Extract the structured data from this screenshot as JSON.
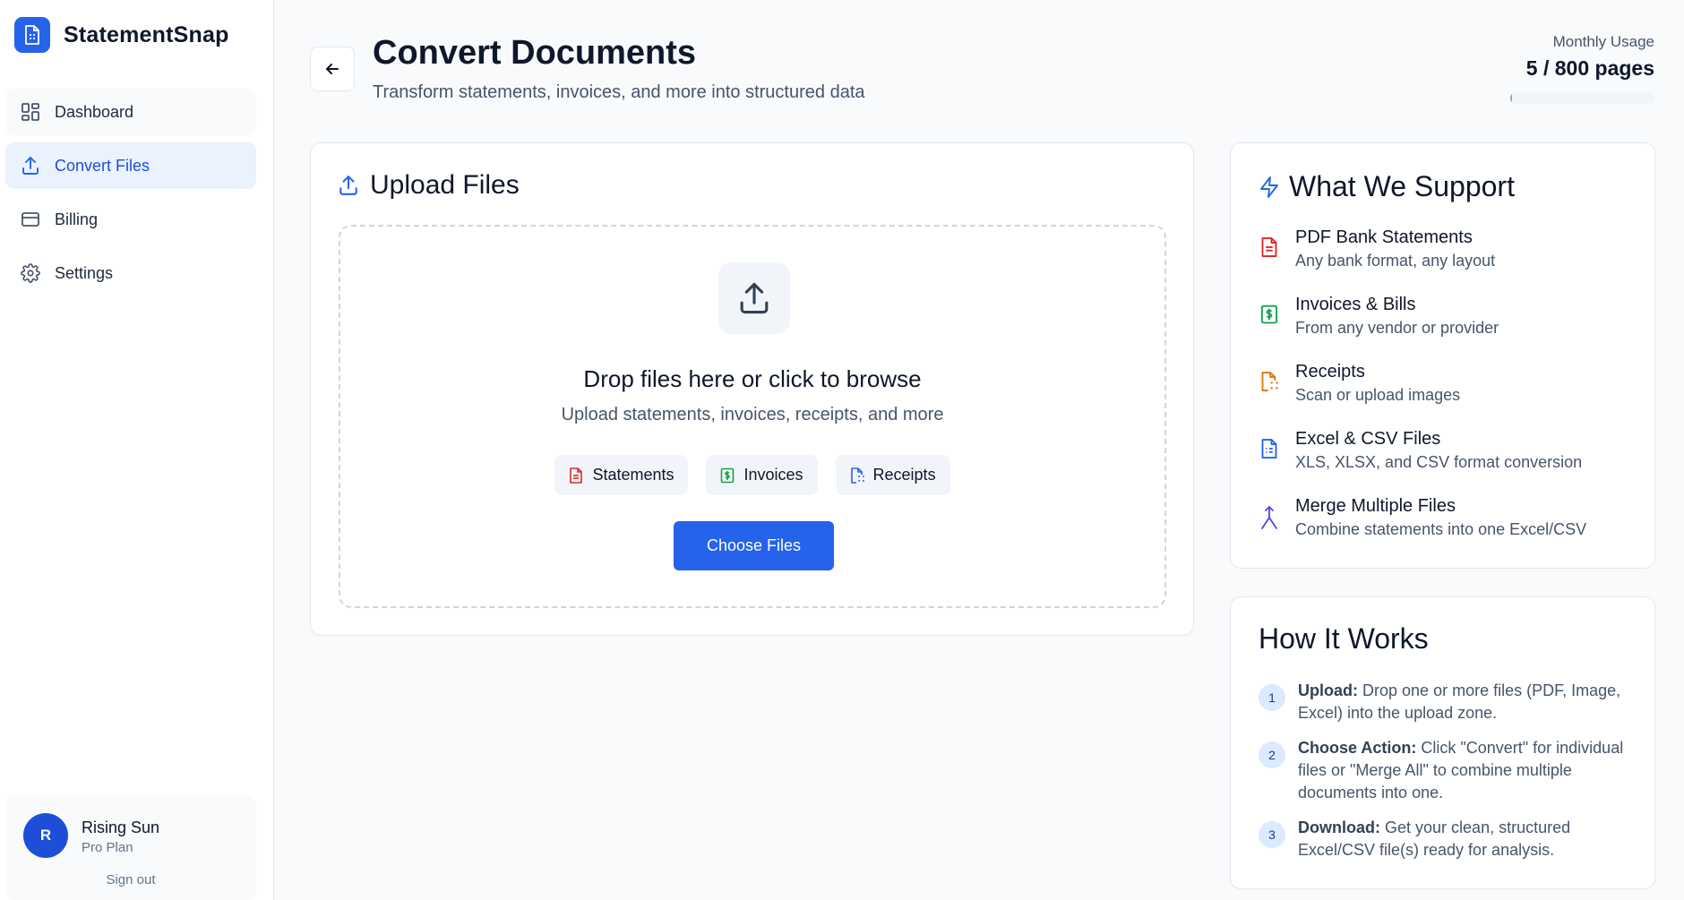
{
  "app": {
    "name": "StatementSnap"
  },
  "sidebar": {
    "items": [
      {
        "label": "Dashboard",
        "icon": "dashboard-grid-icon"
      },
      {
        "label": "Convert Files",
        "icon": "upload-icon",
        "active": true
      },
      {
        "label": "Billing",
        "icon": "credit-card-icon"
      },
      {
        "label": "Settings",
        "icon": "gear-icon"
      }
    ],
    "user": {
      "initial": "R",
      "name": "Rising Sun",
      "plan": "Pro Plan",
      "signout": "Sign out"
    }
  },
  "header": {
    "title": "Convert Documents",
    "subtitle": "Transform statements, invoices, and more into structured data",
    "usage_label": "Monthly Usage",
    "usage_value": "5 / 800 pages",
    "usage_fraction": 0.00625
  },
  "upload": {
    "title": "Upload Files",
    "drop_title": "Drop files here or click to browse",
    "drop_subtitle": "Upload statements, invoices, receipts, and more",
    "chips": [
      {
        "label": "Statements",
        "icon": "file-text-icon",
        "color": "#dc2626"
      },
      {
        "label": "Invoices",
        "icon": "dollar-file-icon",
        "color": "#16a34a"
      },
      {
        "label": "Receipts",
        "icon": "receipt-scan-icon",
        "color": "#2563eb"
      }
    ],
    "choose_label": "Choose Files"
  },
  "support": {
    "title": "What We Support",
    "items": [
      {
        "name": "PDF Bank Statements",
        "desc": "Any bank format, any layout",
        "icon": "file-text-icon",
        "color": "#dc2626"
      },
      {
        "name": "Invoices & Bills",
        "desc": "From any vendor or provider",
        "icon": "dollar-file-icon",
        "color": "#16a34a"
      },
      {
        "name": "Receipts",
        "desc": "Scan or upload images",
        "icon": "receipt-scan-icon",
        "color": "#d97706"
      },
      {
        "name": "Excel & CSV Files",
        "desc": "XLS, XLSX, and CSV format conversion",
        "icon": "spreadsheet-icon",
        "color": "#2563eb"
      },
      {
        "name": "Merge Multiple Files",
        "desc": "Combine statements into one Excel/CSV",
        "icon": "merge-icon",
        "color": "#4f46e5"
      }
    ]
  },
  "how": {
    "title": "How It Works",
    "steps": [
      {
        "num": "1",
        "label": "Upload:",
        "text": "Drop one or more files (PDF, Image, Excel) into the upload zone."
      },
      {
        "num": "2",
        "label": "Choose Action:",
        "text": "Click \"Convert\" for individual files or \"Merge All\" to combine multiple documents into one."
      },
      {
        "num": "3",
        "label": "Download:",
        "text": "Get your clean, structured Excel/CSV file(s) ready for analysis."
      }
    ]
  }
}
